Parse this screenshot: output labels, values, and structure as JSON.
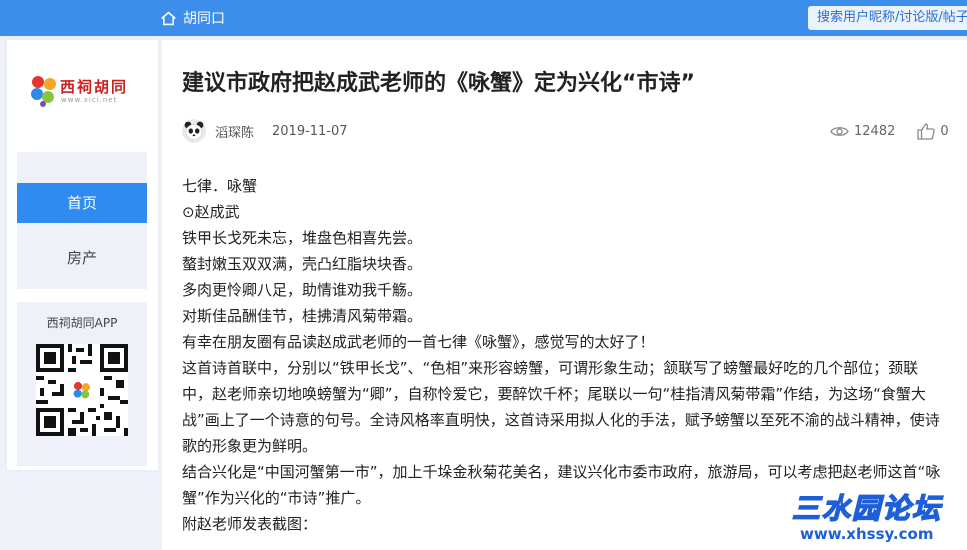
{
  "header": {
    "home_label": "胡同口",
    "search_placeholder": "搜索用户昵称/讨论版/帖子"
  },
  "sidebar": {
    "logo_brand": "西祠胡同",
    "logo_domain": "www.xici.net",
    "nav": [
      {
        "label": "首页",
        "active": true
      },
      {
        "label": "房产",
        "active": false
      }
    ],
    "app_title": "西祠胡同APP"
  },
  "post": {
    "title": "建议市政府把赵成武老师的《咏蟹》定为兴化“市诗”",
    "author": "滔琛陈",
    "date": "2019-11-07",
    "views": "12482",
    "likes": "0",
    "paragraphs": [
      "七律．咏蟹",
      "⊙赵成武",
      "铁甲长戈死未忘，堆盘色相喜先尝。",
      "螯封嫩玉双双满，壳凸红脂块块香。",
      "多肉更怜卿八足，助情谁劝我千觞。",
      "对斯佳品酬佳节，桂拂清风菊带霜。",
      "有幸在朋友圈有品读赵成武老师的一首七律《咏蟹》，感觉写的太好了！",
      "这首诗首联中，分别以“铁甲长戈”、“色相”来形容螃蟹，可谓形象生动；颔联写了螃蟹最好吃的几个部位；颈联中，赵老师亲切地唤螃蟹为“卿”，自称怜爱它，要醉饮千杯；尾联以一句“桂指清风菊带霜”作结，为这场“食蟹大战”画上了一个诗意的句号。全诗风格率直明快，这首诗采用拟人化的手法，赋予螃蟹以至死不渝的战斗精神，使诗歌的形象更为鲜明。",
      "结合兴化是“中国河蟹第一市”，加上千垛金秋菊花美名，建议兴化市委市政府，旅游局，可以考虑把赵老师这首“咏蟹”作为兴化的“市诗”推广。",
      "附赵老师发表截图："
    ]
  },
  "watermark": {
    "text": "三水园论坛",
    "url": "www.xhssy.com"
  },
  "colors": {
    "topbar": "#3d8eea",
    "nav_active": "#2f8bf0",
    "background": "#eef2f8"
  }
}
